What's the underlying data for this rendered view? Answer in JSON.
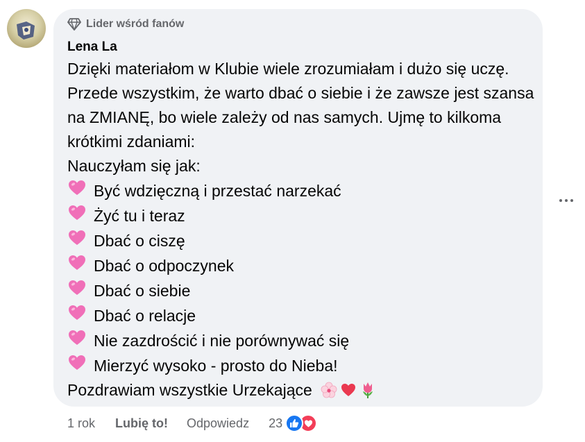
{
  "comment": {
    "author": "Lena La",
    "badge": "Lider wśród fanów",
    "intro": "Dzięki materiałom w Klubie wiele zrozumiałam i dużo się uczę. Przede wszystkim, że warto dbać o siebie i że zawsze jest szansa na ZMIANĘ, bo wiele zależy od nas samych. Ujmę to kilkoma krótkimi zdaniami:",
    "list_header": "Nauczyłam się jak:",
    "items": [
      "Być wdzięczną i przestać narzekać",
      "Żyć tu i teraz",
      "Dbać o ciszę",
      "Dbać o odpoczynek",
      "Dbać o siebie",
      "Dbać o relacje",
      "Nie zazdrościć i nie porównywać się",
      "Mierzyć wysoko - prosto do Nieba!"
    ],
    "closing": "Pozdrawiam wszystkie Urzekające",
    "item_icon": "pink-heart-icon",
    "closing_icons": [
      "cherry-blossom-icon",
      "heart-icon",
      "tulip-icon"
    ]
  },
  "footer": {
    "time": "1 rok",
    "like_label": "Lubię to!",
    "reply_label": "Odpowiedz",
    "reaction_count": "23",
    "reaction_icons": [
      "like-icon",
      "love-icon"
    ]
  },
  "colors": {
    "bubble": "#f0f2f5",
    "meta_text": "#65676b",
    "like_blue": "#1877f2",
    "love_red": "#f33e58",
    "heart_pink": "#f06fb8"
  }
}
